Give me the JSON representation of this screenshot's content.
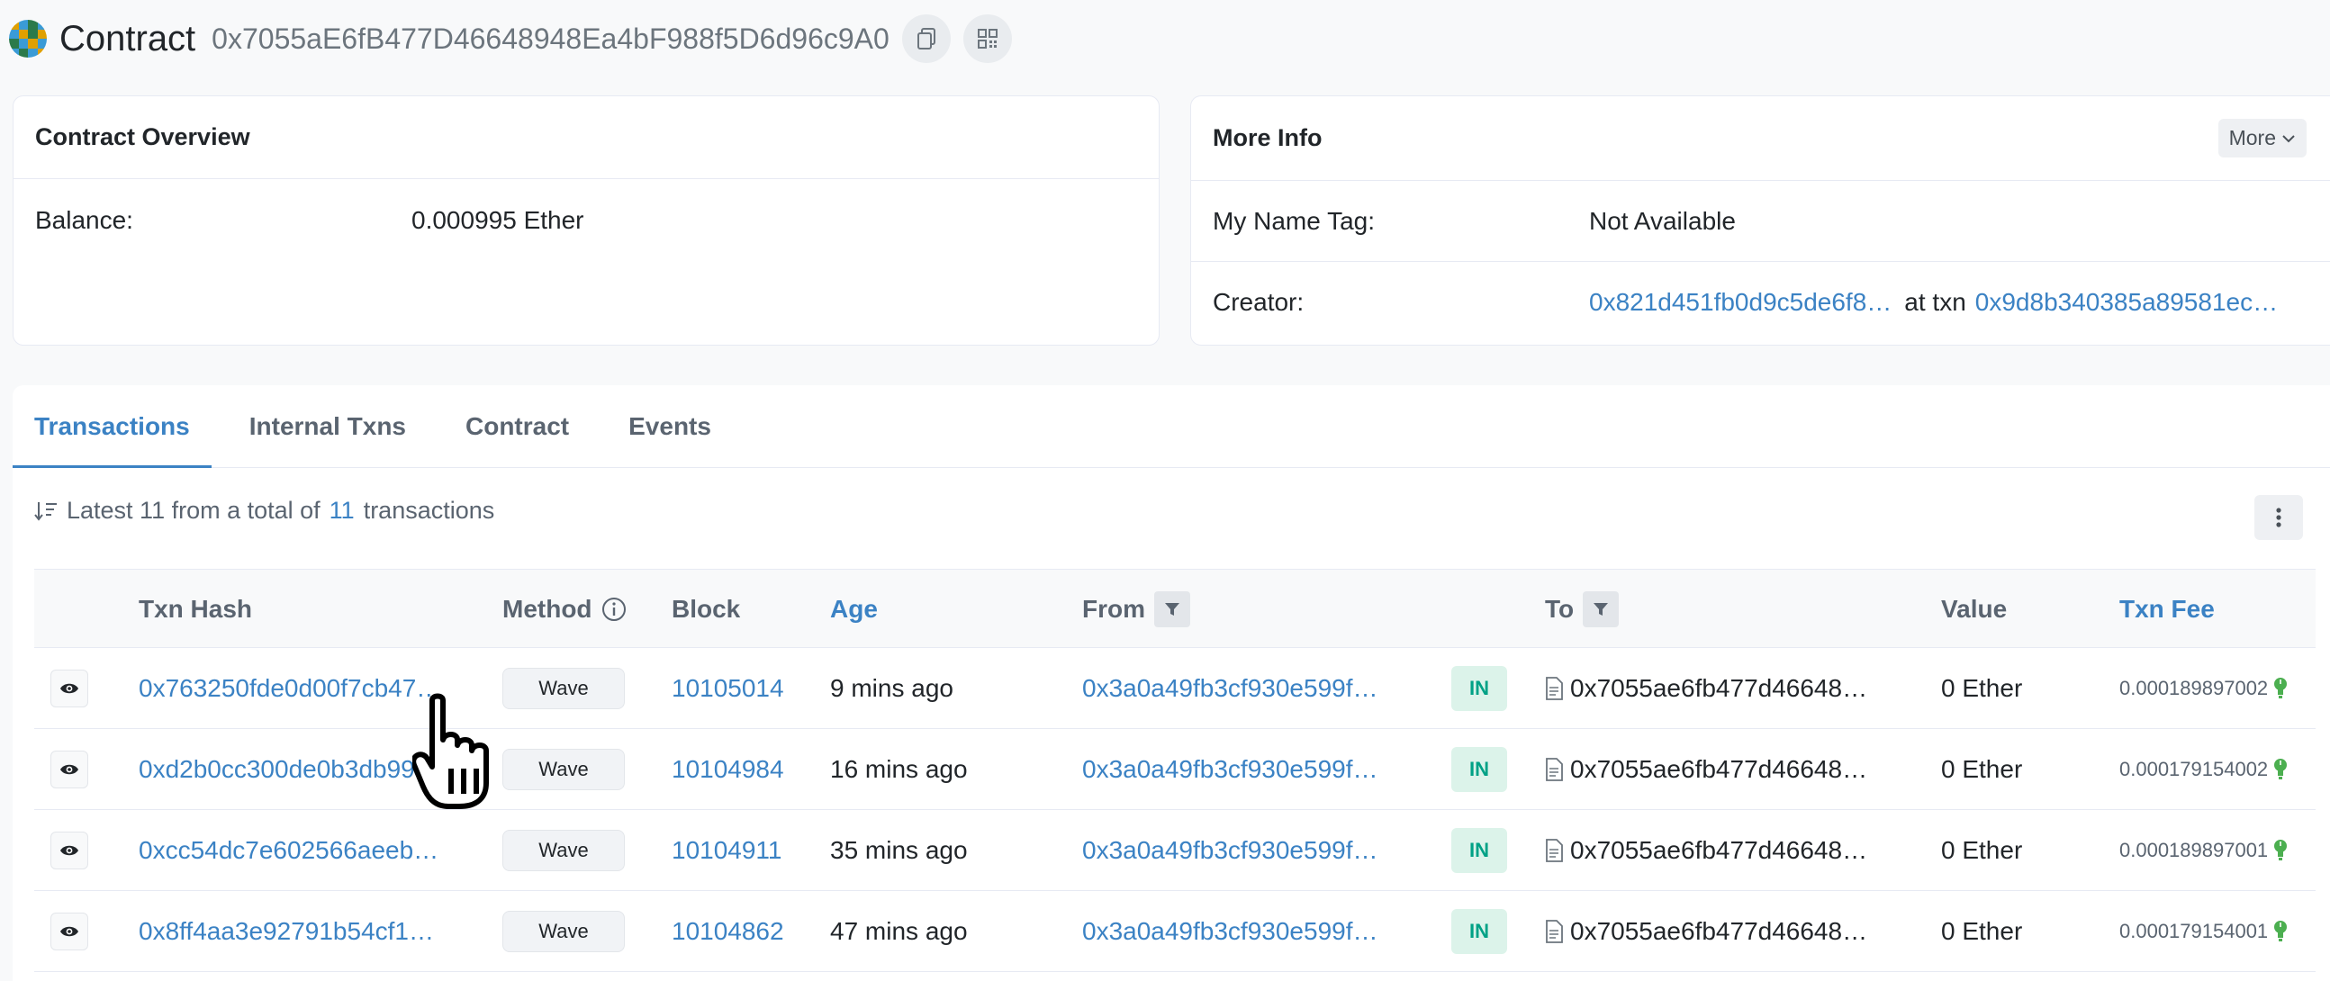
{
  "header": {
    "title": "Contract",
    "address": "0x7055aE6fB477D46648948Ea4bF988f5D6d96c9A0",
    "avatar_colors": [
      "#e0a000",
      "#3a9bd6",
      "#2b7a4b",
      "#3a9bd6",
      "#3a9bd6",
      "#e0a000",
      "#2b7a4b",
      "#e0a000",
      "#2b7a4b",
      "#3a9bd6",
      "#e0a000",
      "#3a9bd6",
      "#3a9bd6",
      "#2b7a4b",
      "#3a9bd6",
      "#e0a000"
    ]
  },
  "overview": {
    "title": "Contract Overview",
    "balance_label": "Balance:",
    "balance_value": "0.000995 Ether"
  },
  "more_info": {
    "title": "More Info",
    "more_button": "More",
    "name_tag_label": "My Name Tag:",
    "name_tag_value": "Not Available",
    "creator_label": "Creator:",
    "creator_address": "0x821d451fb0d9c5de6f8…",
    "at_txn": "at txn",
    "creator_txn": "0x9d8b340385a89581ec…"
  },
  "tabs": [
    {
      "label": "Transactions"
    },
    {
      "label": "Internal Txns"
    },
    {
      "label": "Contract"
    },
    {
      "label": "Events"
    }
  ],
  "summary": {
    "prefix": "Latest 11 from a total of",
    "count": "11",
    "suffix": "transactions"
  },
  "table": {
    "headers": {
      "txn_hash": "Txn Hash",
      "method": "Method",
      "block": "Block",
      "age": "Age",
      "from": "From",
      "to": "To",
      "value": "Value",
      "txn_fee": "Txn Fee"
    },
    "rows": [
      {
        "hash": "0x763250fde0d00f7cb47…",
        "method": "Wave",
        "block": "10105014",
        "age": "9 mins ago",
        "from": "0x3a0a49fb3cf930e599f…",
        "direction": "IN",
        "to": "0x7055ae6fb477d46648…",
        "value": "0 Ether",
        "fee": "0.000189897002"
      },
      {
        "hash": "0xd2b0cc300de0b3db99…",
        "method": "Wave",
        "block": "10104984",
        "age": "16 mins ago",
        "from": "0x3a0a49fb3cf930e599f…",
        "direction": "IN",
        "to": "0x7055ae6fb477d46648…",
        "value": "0 Ether",
        "fee": "0.000179154002"
      },
      {
        "hash": "0xcc54dc7e602566aeeb…",
        "method": "Wave",
        "block": "10104911",
        "age": "35 mins ago",
        "from": "0x3a0a49fb3cf930e599f…",
        "direction": "IN",
        "to": "0x7055ae6fb477d46648…",
        "value": "0 Ether",
        "fee": "0.000189897001"
      },
      {
        "hash": "0x8ff4aa3e92791b54cf1…",
        "method": "Wave",
        "block": "10104862",
        "age": "47 mins ago",
        "from": "0x3a0a49fb3cf930e599f…",
        "direction": "IN",
        "to": "0x7055ae6fb477d46648…",
        "value": "0 Ether",
        "fee": "0.000179154001"
      }
    ]
  },
  "colors": {
    "accent": "#3b82c4",
    "in_badge_bg": "#dcf3ea",
    "in_badge_fg": "#00a186",
    "fee_icon": "#4caf50"
  }
}
